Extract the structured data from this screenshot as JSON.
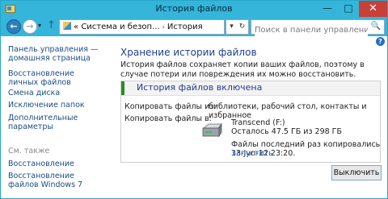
{
  "window": {
    "title": "История файлов",
    "minimize_glyph": "—",
    "maximize_glyph": "□",
    "close_glyph": "✕"
  },
  "nav": {
    "back_glyph": "←",
    "forward_glyph": "→",
    "recent_glyph": "▾",
    "up_glyph": "↑",
    "breadcrumb": {
      "chevron": "«",
      "items": [
        "Система и безоп...",
        "История файлов"
      ],
      "separator": "›"
    },
    "dropdown_glyph": "▾",
    "refresh_glyph": "↻",
    "search_placeholder": "Поиск в панели управления",
    "search_glyph": "🔍"
  },
  "sidebar": {
    "home_link": "Панель управления — домашняя страница",
    "links": [
      "Восстановление личных файлов",
      "Смена диска",
      "Исключение папок",
      "Дополнительные параметры"
    ],
    "see_also_header": "См. также",
    "see_also_links": [
      "Восстановление",
      "Восстановление файлов Windows 7"
    ]
  },
  "main": {
    "help_glyph": "?",
    "title": "Хранение истории файлов",
    "description": "История файлов сохраняет копии ваших файлов, поэтому в случае потери или повреждения их можно восстановить.",
    "status": "История файлов включена",
    "copy_from_label": "Копировать файлы из:",
    "copy_from_value": "библиотеки, рабочий стол, контакты и избранное",
    "copy_to_label": "Копировать файлы в:",
    "drive_name": "Transcend (F:)",
    "drive_free": "Осталось 47.5 ГБ из 298 ГБ",
    "last_copy": "Файлы последний раз копировались 13-Jun-12 23:20.",
    "run_link": "Запустить",
    "off_button": "Выключить"
  },
  "colors": {
    "titlebar": "#34b5d9",
    "close": "#c7403a",
    "link": "#1a4c84",
    "heading": "#1e3d8f",
    "status_accent": "#2a8b2a"
  }
}
